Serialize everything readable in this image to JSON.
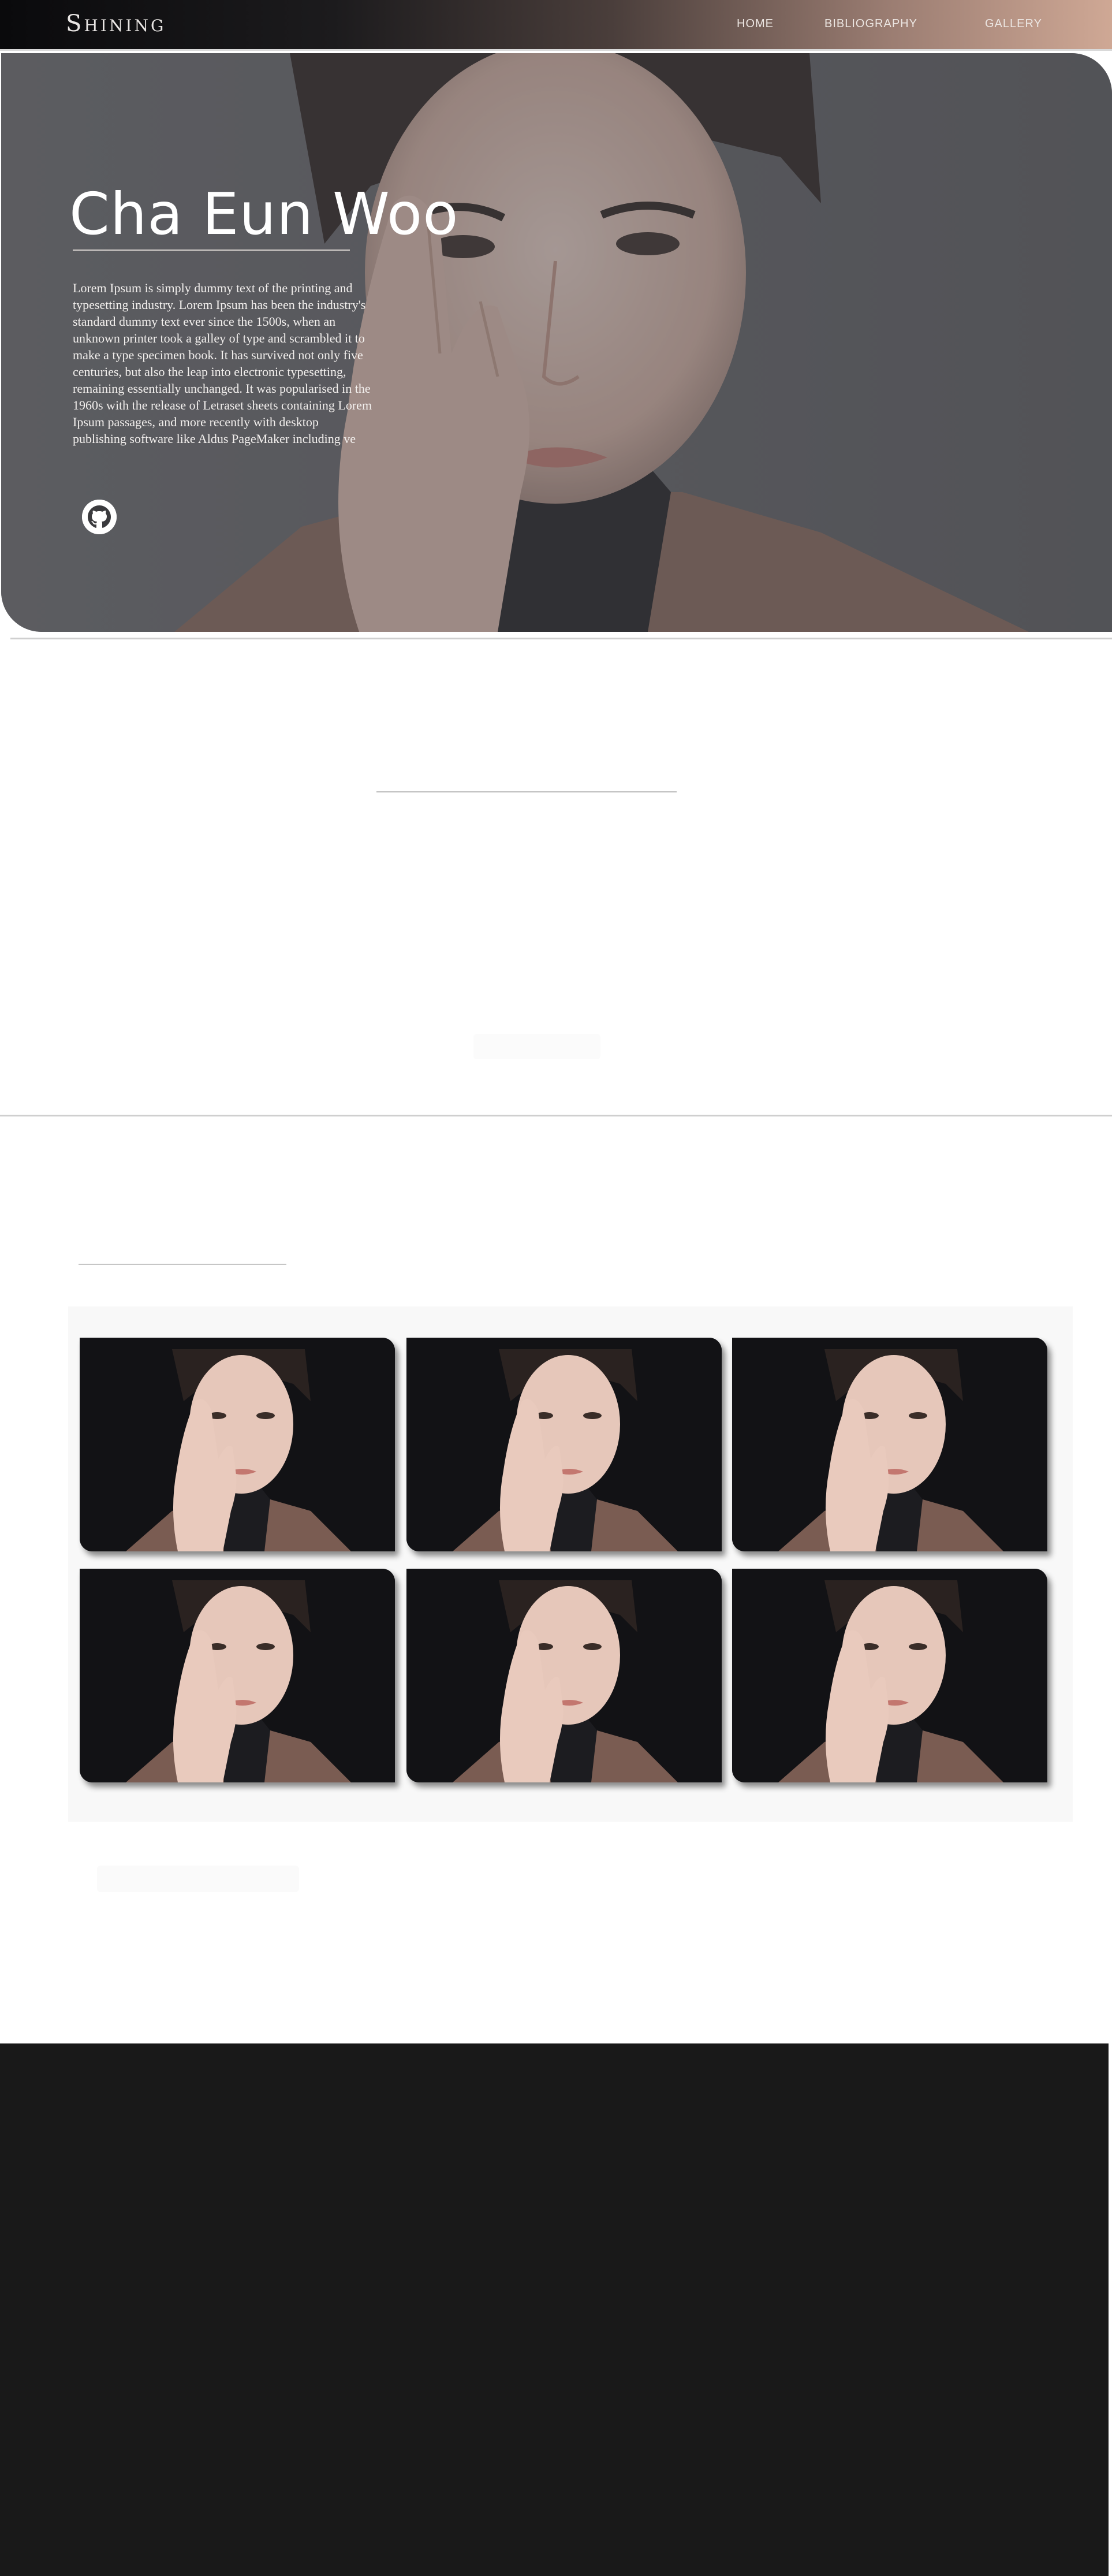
{
  "navbar": {
    "brand": "Shining",
    "links": [
      "HOME",
      "BIBLIOGRAPHY",
      "GALLERY"
    ]
  },
  "hero": {
    "title": "Cha Eun Woo",
    "description": "Lorem Ipsum is simply dummy text of the printing and typesetting industry. Lorem Ipsum has been the industry's standard dummy text ever since the 1500s, when an unknown printer took a galley of type and scrambled it to make a type specimen book. It has survived not only five centuries, but also the leap into electronic typesetting, remaining essentially unchanged. It was popularised in the 1960s with the release of Letraset sheets containing Lorem Ipsum passages, and more recently with desktop publishing software like Aldus PageMaker including ve",
    "social_icon": "github-icon"
  },
  "gallery": {
    "photo_count": 6
  },
  "colors": {
    "footer_bg": "#191919",
    "nav_gradient_start": "#0a0a0c",
    "nav_gradient_end": "#cfa895"
  }
}
